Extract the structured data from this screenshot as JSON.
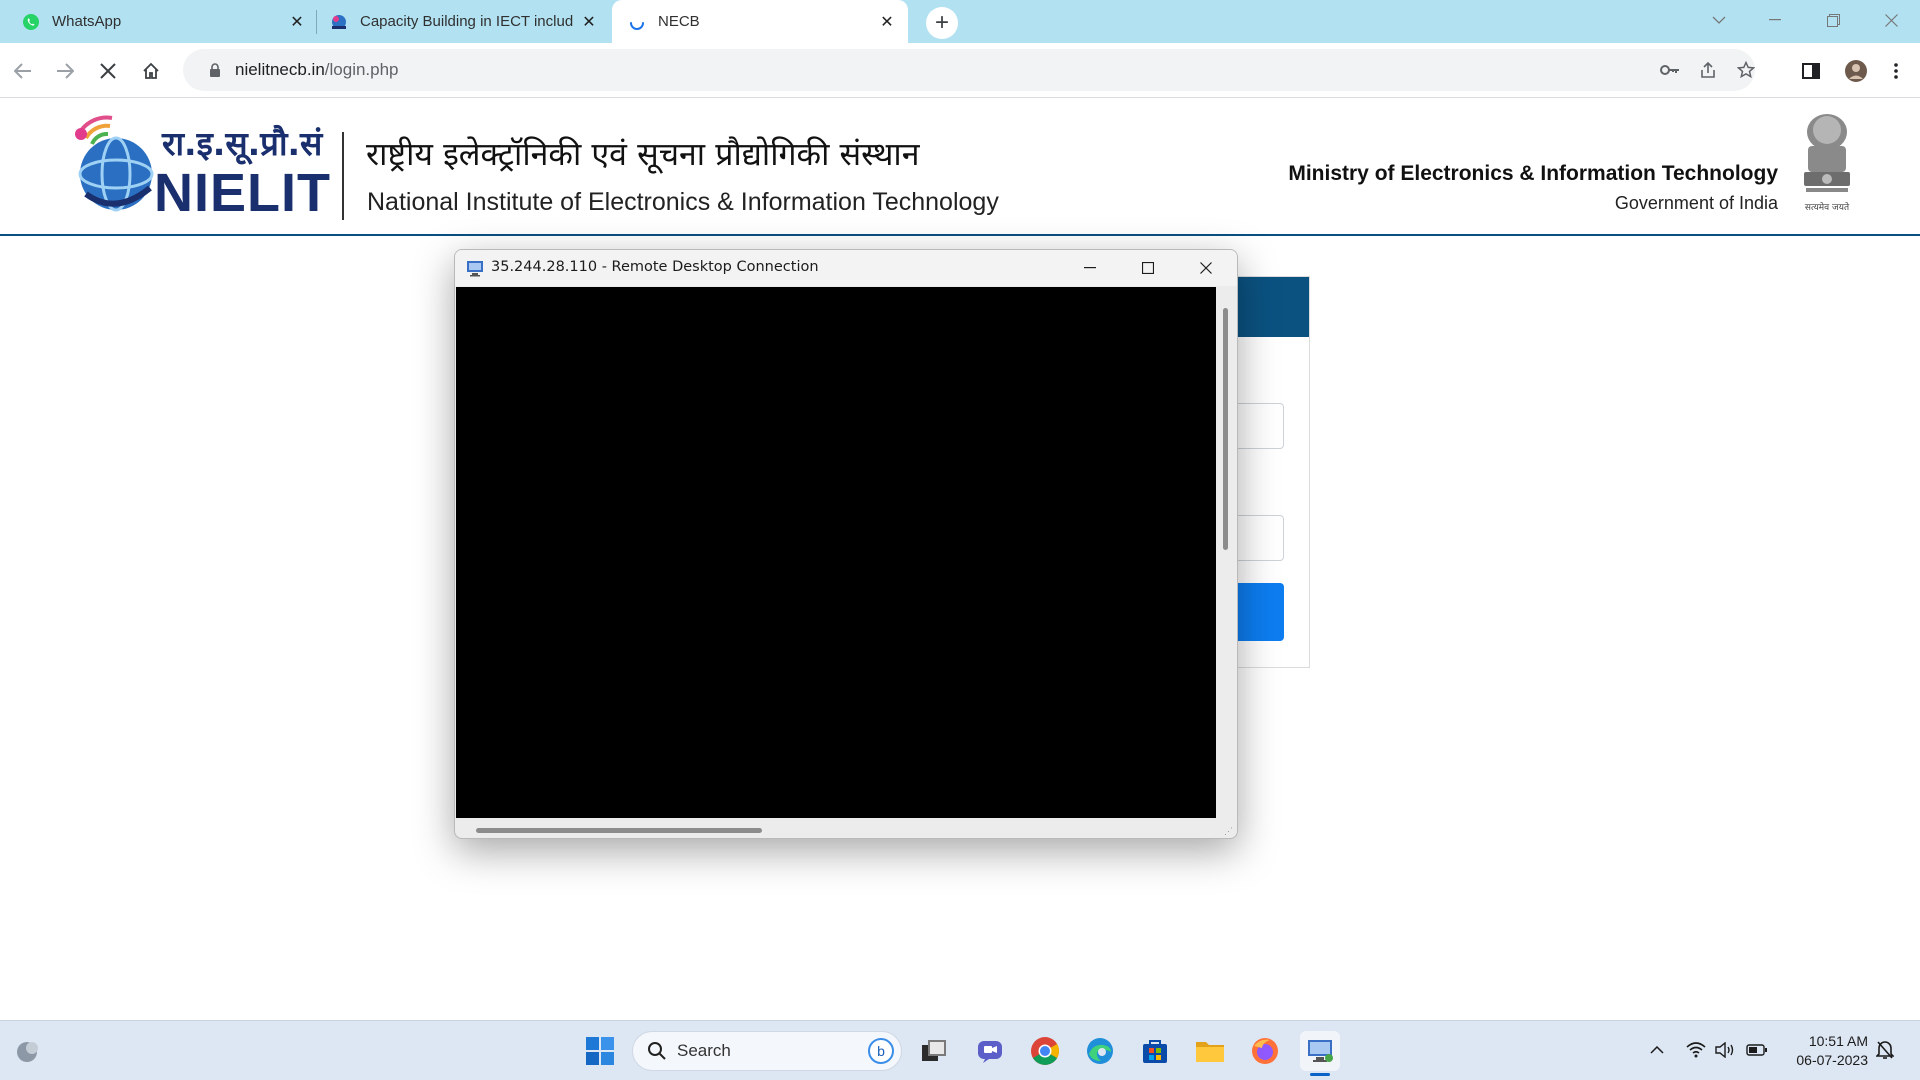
{
  "browser": {
    "tabs": [
      {
        "title": "WhatsApp",
        "favicon": "whatsapp-icon",
        "active": false
      },
      {
        "title": "Capacity Building in IECT includ",
        "favicon": "nielit-favicon",
        "active": false
      },
      {
        "title": "NECB",
        "favicon": "loading-spinner-icon",
        "active": true
      }
    ],
    "new_tab_symbol": "+",
    "url_host": "nielitnecb.in",
    "url_path": "/login.php"
  },
  "page": {
    "logo_hindi": "रा.इ.सू.प्रौ.सं",
    "logo_text": "NIELIT",
    "hindi_title": "राष्ट्रीय इलेक्ट्रॉनिकी एवं सूचना प्रौद्योगिकी संस्थान",
    "english_title": "National Institute of Electronics & Information Technology",
    "ministry": "Ministry of Electronics & Information Technology",
    "government": "Government of India",
    "emblem_caption": "सत्यमेव जयते",
    "colors": {
      "header_rule": "#0a4f82",
      "card_head": "#0b5281",
      "login_button": "#0d7df0"
    }
  },
  "rdp_window": {
    "title": "35.244.28.110 - Remote Desktop Connection"
  },
  "taskbar": {
    "search_label": "Search",
    "apps": [
      "start-icon",
      "search",
      "copilot-icon",
      "task-view-icon",
      "teams-icon",
      "chrome-icon",
      "edge-icon",
      "store-icon",
      "file-explorer-icon",
      "firefox-icon",
      "remote-desktop-icon"
    ],
    "time": "10:51 AM",
    "date": "06-07-2023"
  }
}
